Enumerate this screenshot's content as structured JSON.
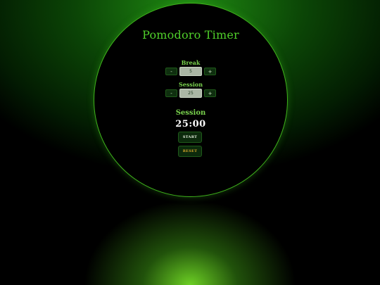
{
  "app": {
    "title": "Pomodoro Timer"
  },
  "break": {
    "label": "Break",
    "value": "5",
    "decrement_label": "-",
    "increment_label": "+"
  },
  "session": {
    "label": "Session",
    "value": "25",
    "decrement_label": "-",
    "increment_label": "+"
  },
  "timer": {
    "mode_label": "Session",
    "time_left": "25:00"
  },
  "controls": {
    "start_label": "START",
    "reset_label": "RESET"
  },
  "colors": {
    "accent": "#4fcf2a",
    "label": "#7ad44e",
    "reset_text": "#d9a62a",
    "clock_face": "#000000"
  }
}
